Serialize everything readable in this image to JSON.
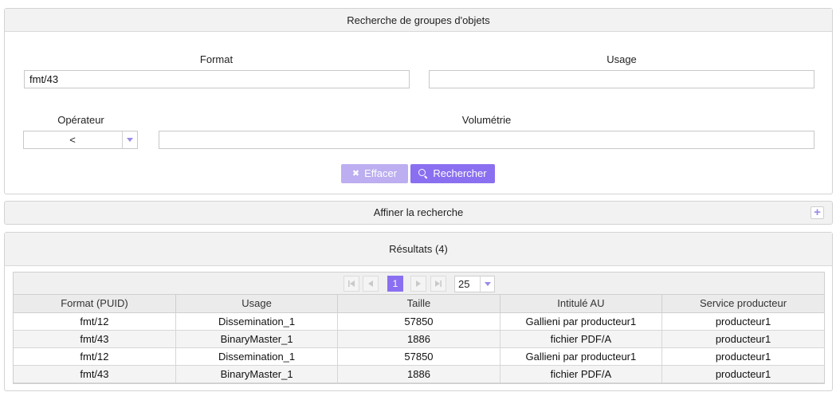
{
  "search": {
    "title": "Recherche de groupes d'objets",
    "format_label": "Format",
    "format_value": "fmt/43",
    "usage_label": "Usage",
    "usage_value": "",
    "operator_label": "Opérateur",
    "operator_value": "<",
    "volume_label": "Volumétrie",
    "volume_value": "",
    "clear_label": "Effacer",
    "search_label": "Rechercher",
    "accent_color": "#8a6ff0"
  },
  "refine": {
    "title": "Affiner la recherche",
    "expand_icon": "plus-icon"
  },
  "results": {
    "title": "Résultats (4)",
    "pager": {
      "current_page": "1",
      "page_size": "25"
    },
    "columns": [
      "Format (PUID)",
      "Usage",
      "Taille",
      "Intitulé AU",
      "Service producteur"
    ],
    "rows": [
      [
        "fmt/12",
        "Dissemination_1",
        "57850",
        "Gallieni par producteur1",
        "producteur1"
      ],
      [
        "fmt/43",
        "BinaryMaster_1",
        "1886",
        "fichier PDF/A",
        "producteur1"
      ],
      [
        "fmt/12",
        "Dissemination_1",
        "57850",
        "Gallieni par producteur1",
        "producteur1"
      ],
      [
        "fmt/43",
        "BinaryMaster_1",
        "1886",
        "fichier PDF/A",
        "producteur1"
      ]
    ]
  }
}
